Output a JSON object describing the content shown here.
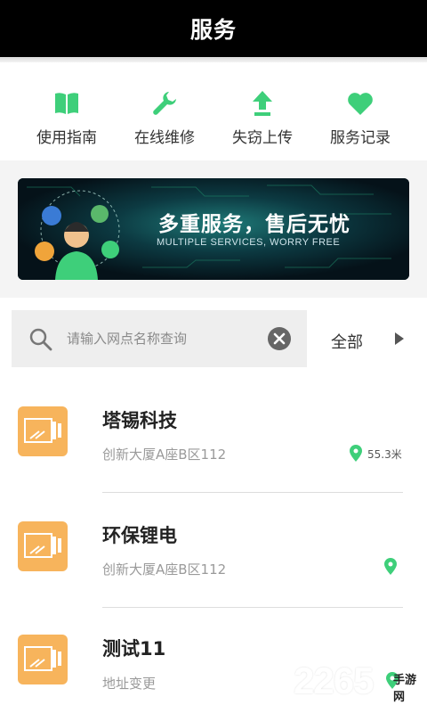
{
  "header": {
    "title": "服务"
  },
  "quick_actions": [
    {
      "label": "使用指南",
      "icon": "book-icon"
    },
    {
      "label": "在线维修",
      "icon": "wrench-icon"
    },
    {
      "label": "失窃上传",
      "icon": "upload-arrow-icon"
    },
    {
      "label": "服务记录",
      "icon": "heart-icon"
    }
  ],
  "banner": {
    "title": "多重服务，售后无忧",
    "subtitle": "MULTIPLE SERVICES, WORRY FREE"
  },
  "search": {
    "placeholder": "请输入网点名称查询",
    "value": ""
  },
  "filter": {
    "label": "全部"
  },
  "outlets": [
    {
      "name": "塔锡科技",
      "address": "创新大厦A座B区112",
      "distance": "55.3米"
    },
    {
      "name": "环保锂电",
      "address": "创新大厦A座B区112",
      "distance": ""
    },
    {
      "name": "测试11",
      "address": "地址变更",
      "distance": ""
    }
  ],
  "watermark": {
    "digits": "2265",
    "text": "手游网"
  },
  "colors": {
    "accent_green": "#3ecf7a",
    "header_bg": "#000000",
    "thumb_orange": "#f7b45c"
  }
}
